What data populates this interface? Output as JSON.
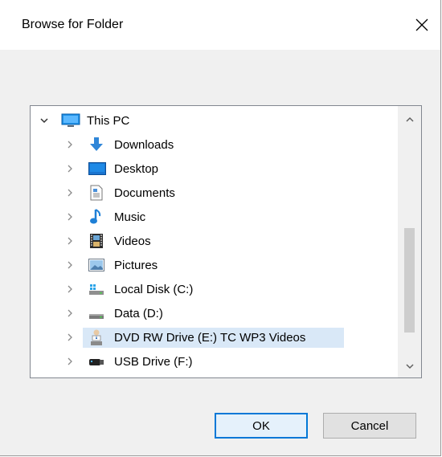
{
  "window": {
    "title": "Browse for Folder",
    "close_icon": "close-icon"
  },
  "tree": {
    "root": {
      "label": "This PC",
      "icon": "this-pc-icon",
      "expanded": true
    },
    "items": [
      {
        "label": "Downloads",
        "icon": "downloads-icon"
      },
      {
        "label": "Desktop",
        "icon": "desktop-icon"
      },
      {
        "label": "Documents",
        "icon": "documents-icon"
      },
      {
        "label": "Music",
        "icon": "music-icon"
      },
      {
        "label": "Videos",
        "icon": "videos-icon"
      },
      {
        "label": "Pictures",
        "icon": "pictures-icon"
      },
      {
        "label": "Local Disk (C:)",
        "icon": "local-disk-icon"
      },
      {
        "label": "Data (D:)",
        "icon": "drive-icon"
      },
      {
        "label": "DVD RW Drive (E:) TC WP3 Videos",
        "icon": "dvd-drive-icon",
        "selected": true
      },
      {
        "label": "USB Drive (F:)",
        "icon": "usb-drive-icon"
      }
    ]
  },
  "buttons": {
    "ok": "OK",
    "cancel": "Cancel"
  },
  "colors": {
    "selection": "#d9e8f7",
    "accent": "#0078d7"
  }
}
